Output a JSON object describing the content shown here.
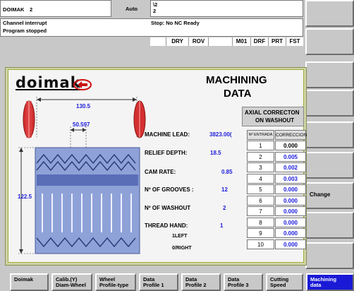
{
  "header": {
    "machine": "DOIMAK",
    "channel_no": "2",
    "mode": "Auto",
    "program": "\\2\n2",
    "channel_state": "Channel interrupt",
    "stop_state": "Stop: No NC Ready",
    "program_state": "Program stopped",
    "indicators": [
      "DRY",
      "ROV",
      "M01",
      "DRF",
      "PRT",
      "FST"
    ]
  },
  "panel": {
    "logo_text": "doimak",
    "title_line1": "MACHINING",
    "title_line2": "DATA",
    "axial_line1": "AXIAL CORRECTON",
    "axial_line2": "ON WASHOUT",
    "dim_width": "130.5",
    "dim_pitch": "50.597",
    "dim_height": "122.5",
    "params": [
      {
        "label": "MACHINE LEAD:",
        "value": "3823.00("
      },
      {
        "label": "RELIEF DEPTH:",
        "value": "18.5"
      },
      {
        "label": "CAM RATE:",
        "value": "0.85"
      },
      {
        "label": "Nº OF GROOVES :",
        "value": "12"
      },
      {
        "label": "Nº OF WASHOUT",
        "value": "2"
      },
      {
        "label": "THREAD HAND:",
        "value": "1"
      }
    ],
    "hand_opt1": "1LEFT",
    "hand_opt2": "0/RIGHT",
    "table": {
      "col1": "Nº ENTRADA",
      "col2": "CORRECCION",
      "rows": [
        {
          "idx": "1",
          "val": "0.000"
        },
        {
          "idx": "2",
          "val": "0.005"
        },
        {
          "idx": "3",
          "val": "0.002"
        },
        {
          "idx": "4",
          "val": "0.003"
        },
        {
          "idx": "5",
          "val": "0.000"
        },
        {
          "idx": "6",
          "val": "0.000"
        },
        {
          "idx": "7",
          "val": "0.000"
        },
        {
          "idx": "8",
          "val": "0.000"
        },
        {
          "idx": "9",
          "val": "0.000"
        },
        {
          "idx": "10",
          "val": "0.000"
        }
      ]
    }
  },
  "softkeys_vertical": [
    "",
    "",
    "",
    "",
    "",
    "",
    "Change",
    "",
    ""
  ],
  "softkeys_horizontal": [
    {
      "label": "Doimak",
      "active": false
    },
    {
      "label": "Calib.(Y)\nDiam-Wheel",
      "active": false
    },
    {
      "label": "Wheel\nProfile-type",
      "active": false
    },
    {
      "label": "Data\nProfile 1",
      "active": false
    },
    {
      "label": "Data\nProfile 2",
      "active": false
    },
    {
      "label": "Data\nProfile 3",
      "active": false
    },
    {
      "label": "Cutting\nSpeed",
      "active": false
    },
    {
      "label": "Machining\ndata",
      "active": true
    }
  ],
  "colors": {
    "value_blue": "#1c1cdc",
    "active_key": "#1a1ad6",
    "logo_red": "#cc1010"
  }
}
